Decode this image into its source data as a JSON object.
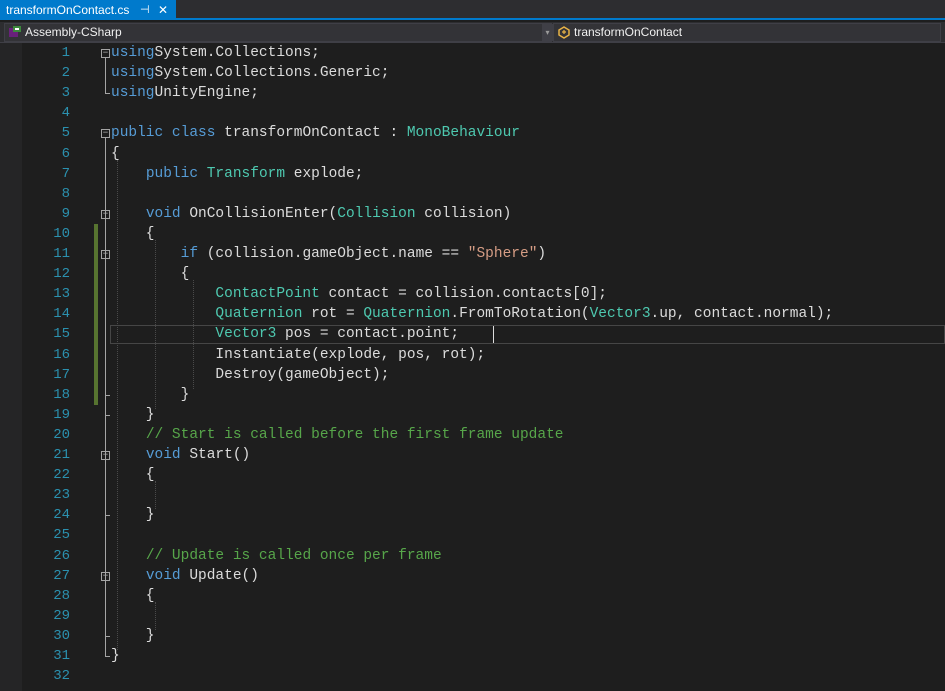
{
  "tab": {
    "title": "transformOnContact.cs",
    "pin_glyph": "⊣",
    "close_glyph": "✕"
  },
  "nav": {
    "project": "Assembly-CSharp",
    "class": "transformOnContact",
    "dropdown_glyph": "▾"
  },
  "colors": {
    "keyword": "#569cd6",
    "type": "#4ec9b0",
    "string": "#d69d85",
    "comment": "#57a64a",
    "line_number": "#2b91af",
    "accent": "#007acc"
  },
  "editor": {
    "current_line": 15,
    "lines": [
      {
        "n": "1",
        "tokens": [
          [
            "kw",
            "using"
          ],
          [
            "",
            "System.Collections;"
          ]
        ]
      },
      {
        "n": "2",
        "tokens": [
          [
            "kw",
            "using"
          ],
          [
            "",
            "System.Collections.Generic;"
          ]
        ]
      },
      {
        "n": "3",
        "tokens": [
          [
            "kw",
            "using"
          ],
          [
            "",
            "UnityEngine;"
          ]
        ]
      },
      {
        "n": "4",
        "tokens": []
      },
      {
        "n": "5",
        "tokens": [
          [
            "kw",
            "public class "
          ],
          [
            "",
            "transformOnContact : "
          ],
          [
            "ty",
            "MonoBehaviour"
          ]
        ]
      },
      {
        "n": "6",
        "tokens": [
          [
            "",
            "{"
          ]
        ]
      },
      {
        "n": "7",
        "tokens": [
          [
            "",
            "    "
          ],
          [
            "kw",
            "public "
          ],
          [
            "ty",
            "Transform"
          ],
          [
            "",
            " explode;"
          ]
        ]
      },
      {
        "n": "8",
        "tokens": []
      },
      {
        "n": "9",
        "tokens": [
          [
            "",
            "    "
          ],
          [
            "kw",
            "void "
          ],
          [
            "",
            "OnCollisionEnter("
          ],
          [
            "ty",
            "Collision"
          ],
          [
            "",
            " collision)"
          ]
        ]
      },
      {
        "n": "10",
        "tokens": [
          [
            "",
            "    {"
          ]
        ]
      },
      {
        "n": "11",
        "tokens": [
          [
            "",
            "        "
          ],
          [
            "kw",
            "if"
          ],
          [
            "",
            " (collision.gameObject.name == "
          ],
          [
            "st",
            "\"Sphere\""
          ],
          [
            "",
            ")"
          ]
        ]
      },
      {
        "n": "12",
        "tokens": [
          [
            "",
            "        {"
          ]
        ]
      },
      {
        "n": "13",
        "tokens": [
          [
            "",
            "            "
          ],
          [
            "ty",
            "ContactPoint"
          ],
          [
            "",
            " contact = collision.contacts[0];"
          ]
        ]
      },
      {
        "n": "14",
        "tokens": [
          [
            "",
            "            "
          ],
          [
            "ty",
            "Quaternion"
          ],
          [
            "",
            " rot = "
          ],
          [
            "ty",
            "Quaternion"
          ],
          [
            "",
            ".FromToRotation("
          ],
          [
            "ty",
            "Vector3"
          ],
          [
            "",
            ".up, contact.normal);"
          ]
        ]
      },
      {
        "n": "15",
        "tokens": [
          [
            "",
            "            "
          ],
          [
            "ty",
            "Vector3"
          ],
          [
            "",
            " pos = contact.point;"
          ]
        ]
      },
      {
        "n": "16",
        "tokens": [
          [
            "",
            "            Instantiate(explode, pos, rot);"
          ]
        ]
      },
      {
        "n": "17",
        "tokens": [
          [
            "",
            "            Destroy(gameObject);"
          ]
        ]
      },
      {
        "n": "18",
        "tokens": [
          [
            "",
            "        }"
          ]
        ]
      },
      {
        "n": "19",
        "tokens": [
          [
            "",
            "    }"
          ]
        ]
      },
      {
        "n": "20",
        "tokens": [
          [
            "",
            "    "
          ],
          [
            "cm",
            "// Start is called before the first frame update"
          ]
        ]
      },
      {
        "n": "21",
        "tokens": [
          [
            "",
            "    "
          ],
          [
            "kw",
            "void "
          ],
          [
            "",
            "Start()"
          ]
        ]
      },
      {
        "n": "22",
        "tokens": [
          [
            "",
            "    {"
          ]
        ]
      },
      {
        "n": "23",
        "tokens": []
      },
      {
        "n": "24",
        "tokens": [
          [
            "",
            "    }"
          ]
        ]
      },
      {
        "n": "25",
        "tokens": []
      },
      {
        "n": "26",
        "tokens": [
          [
            "",
            "    "
          ],
          [
            "cm",
            "// Update is called once per frame"
          ]
        ]
      },
      {
        "n": "27",
        "tokens": [
          [
            "",
            "    "
          ],
          [
            "kw",
            "void "
          ],
          [
            "",
            "Update()"
          ]
        ]
      },
      {
        "n": "28",
        "tokens": [
          [
            "",
            "    {"
          ]
        ]
      },
      {
        "n": "29",
        "tokens": []
      },
      {
        "n": "30",
        "tokens": [
          [
            "",
            "    }"
          ]
        ]
      },
      {
        "n": "31",
        "tokens": [
          [
            "",
            "}"
          ]
        ]
      },
      {
        "n": "32",
        "tokens": []
      }
    ]
  }
}
